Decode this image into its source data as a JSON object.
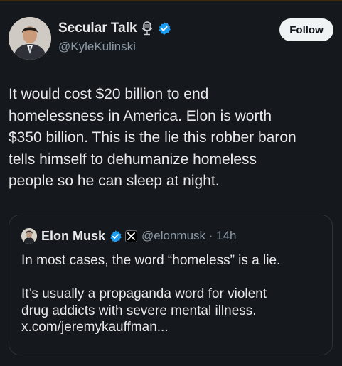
{
  "colors": {
    "background": "#15181c",
    "text": "#e7e9ea",
    "secondary_text": "#8b98a5",
    "verified_blue": "#1d9bf0",
    "follow_bg": "#eff3f4"
  },
  "author": {
    "display_name": "Secular Talk",
    "handle": "@KyleKulinski",
    "badges": [
      "microphone-icon",
      "verified-icon"
    ]
  },
  "follow_button": {
    "label": "Follow"
  },
  "tweet": {
    "text": "It would cost $20 billion to end\nhomelessness in America. Elon is worth\n$350 billion. This is the lie this robber baron\ntells himself to dehumanize homeless\npeople so he can sleep at night."
  },
  "quoted_tweet": {
    "display_name": "Elon Musk",
    "handle_time": "@elonmusk · 14h",
    "badges": [
      "verified-icon",
      "x-affiliate-icon"
    ],
    "text": "In most cases, the word “homeless” is a lie.\n\nIt’s usually a propaganda word for violent\ndrug addicts with severe mental illness.\nx.com/jeremykauffman..."
  }
}
